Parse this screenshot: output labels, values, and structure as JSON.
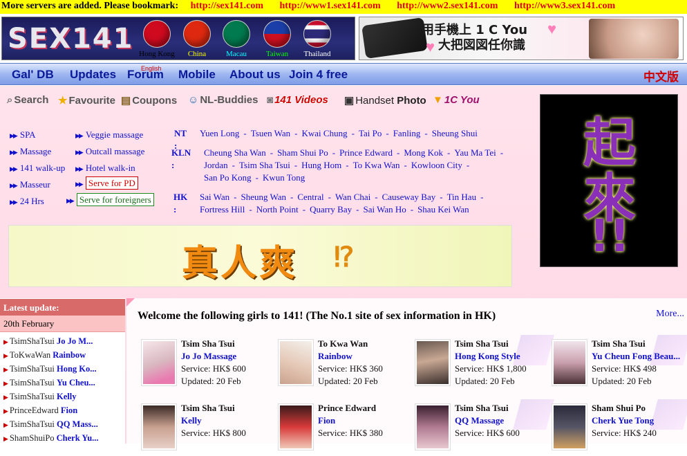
{
  "topbar": {
    "notice": "More servers are added. Please bookmark:",
    "links": [
      "http://sex141.com",
      "http://www1.sex141.com",
      "http://www2.sex141.com",
      "http://www3.sex141.com"
    ]
  },
  "banner": {
    "logo": "SEX141",
    "flags": [
      {
        "label": "Hong Kong",
        "color": "#cf0a1f",
        "label_color": "#000000"
      },
      {
        "label": "China",
        "color": "#de2910",
        "label_color": "#ffff00"
      },
      {
        "label": "Macau",
        "color": "#007a4e",
        "label_color": "#00ffff"
      },
      {
        "label": "Taiwan",
        "color": "#1b3fa8",
        "label_color": "#00ff00"
      },
      {
        "label": "Thailand",
        "color": "#2d2a78",
        "label_color": "#ffffff"
      }
    ],
    "ad_line1": "用手機上 1 C You",
    "ad_line2": "大把図図任你識"
  },
  "nav": {
    "items": [
      "Gal' DB",
      "Updates",
      "Forum",
      "Mobile",
      "About us",
      "Join 4 free"
    ],
    "forum_sub": "English",
    "lang": "中文版"
  },
  "quick": {
    "search": "Search",
    "favourite": "Favourite",
    "coupons": "Coupons",
    "nl_buddies": "NL-Buddies",
    "videos": "141 Videos",
    "handset_a": "Handset",
    "handset_b": "Photo",
    "icyou": "1C You"
  },
  "categories": {
    "col1": [
      "SPA",
      "Massage",
      "141 walk-up",
      "Masseur",
      "24 Hrs"
    ],
    "col2": [
      "Veggie massage",
      "Outcall massage",
      "Hotel walk-in"
    ],
    "pd": "Serve for PD",
    "foreigners": "Serve for foreigners"
  },
  "areas": {
    "nt_label": "NT :",
    "nt": [
      "Yuen Long",
      "Tsuen Wan",
      "Kwai Chung",
      "Tai Po",
      "Fanling",
      "Sheung Shui"
    ],
    "kln_label": "KLN :",
    "kln_row1": [
      "Cheung Sha Wan",
      "Sham Shui Po",
      "Prince Edward",
      "Mong Kok",
      "Yau Ma Tei"
    ],
    "kln_row2": [
      "Jordan",
      "Tsim Sha Tsui",
      "Hung Hom",
      "To Kwa Wan",
      "Kowloon City"
    ],
    "kln_row3": [
      "San Po Kong",
      "Kwun Tong"
    ],
    "hk_label": "HK :",
    "hk_row1": [
      "Sai Wan",
      "Sheung Wan",
      "Central",
      "Wan Chai",
      "Causeway Bay",
      "Tin Hau"
    ],
    "hk_row2": [
      "Fortress Hill",
      "North Point",
      "Quarry Bay",
      "Sai Wan Ho",
      "Shau Kei Wan"
    ]
  },
  "ads": {
    "big_top": "起",
    "big_mid": "來",
    "big_bottom": "!!",
    "yellow": "真人爽",
    "yellow_mark": "⁉"
  },
  "sidebar": {
    "heading": "Latest update:",
    "date": "20th February",
    "items": [
      {
        "area": "TsimShaTsui",
        "name": "Jo Jo M..."
      },
      {
        "area": "ToKwaWan",
        "name": "Rainbow"
      },
      {
        "area": "TsimShaTsui",
        "name": "Hong Ko..."
      },
      {
        "area": "TsimShaTsui",
        "name": "Yu Cheu..."
      },
      {
        "area": "TsimShaTsui",
        "name": "Kelly"
      },
      {
        "area": "PrinceEdward",
        "name": "Fion"
      },
      {
        "area": "TsimShaTsui",
        "name": "QQ Mass..."
      },
      {
        "area": "ShamShuiPo",
        "name": "Cherk Yu..."
      }
    ]
  },
  "content": {
    "welcome": "Welcome the following girls to 141! (The No.1 site of sex information in HK)",
    "more": "More...",
    "cards": [
      {
        "location": "Tsim Sha Tsui",
        "name": "Jo Jo Massage",
        "service": "Service: HK$ 600",
        "updated": "Updated: 20 Feb"
      },
      {
        "location": "To Kwa Wan",
        "name": "Rainbow",
        "service": "Service: HK$ 360",
        "updated": "Updated: 20 Feb"
      },
      {
        "location": "Tsim Sha Tsui",
        "name": "Hong Kong Style",
        "service": "Service: HK$ 1,800",
        "updated": "Updated: 20 Feb"
      },
      {
        "location": "Tsim Sha Tsui",
        "name": "Yu Cheun Fong Beau...",
        "service": "Service: HK$ 498",
        "updated": "Updated: 20 Feb"
      },
      {
        "location": "Tsim Sha Tsui",
        "name": "Kelly",
        "service": "Service: HK$ 800",
        "updated": ""
      },
      {
        "location": "Prince Edward",
        "name": "Fion",
        "service": "Service: HK$ 380",
        "updated": ""
      },
      {
        "location": "Tsim Sha Tsui",
        "name": "QQ Massage",
        "service": "Service: HK$ 600",
        "updated": ""
      },
      {
        "location": "Sham Shui Po",
        "name": "Cherk Yue Tong",
        "service": "Service: HK$ 240",
        "updated": ""
      }
    ]
  }
}
